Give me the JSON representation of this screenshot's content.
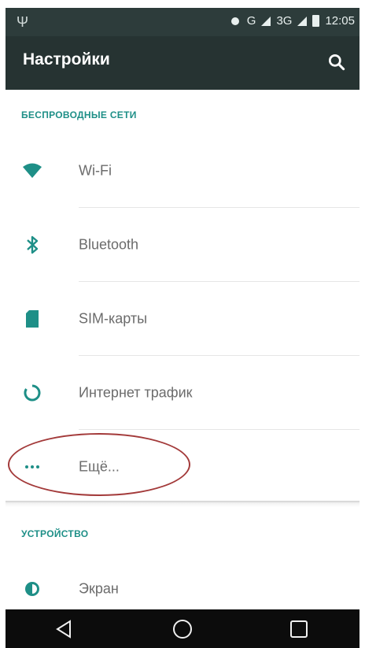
{
  "status_bar": {
    "network_label": "G",
    "data_label": "3G",
    "time": "12:05"
  },
  "app_bar": {
    "title": "Настройки",
    "search_icon": "search-icon"
  },
  "sections": [
    {
      "header": "БЕСПРОВОДНЫЕ СЕТИ",
      "items": [
        {
          "label": "Wi-Fi",
          "icon": "wifi-icon"
        },
        {
          "label": "Bluetooth",
          "icon": "bluetooth-icon"
        },
        {
          "label": "SIM-карты",
          "icon": "sim-card-icon"
        },
        {
          "label": "Интернет трафик",
          "icon": "data-usage-icon"
        },
        {
          "label": "Ещё...",
          "icon": "more-icon"
        }
      ]
    },
    {
      "header": "УСТРОЙСТВО",
      "items": [
        {
          "label": "Экран",
          "icon": "display-icon"
        }
      ]
    }
  ],
  "nav_bar": {
    "back": "back-icon",
    "home": "home-icon",
    "recents": "recents-icon"
  },
  "colors": {
    "app_bar": "#263332",
    "status_bar": "#2d3c3b",
    "accent": "#1e8f87",
    "annotation": "#a33a3a"
  }
}
